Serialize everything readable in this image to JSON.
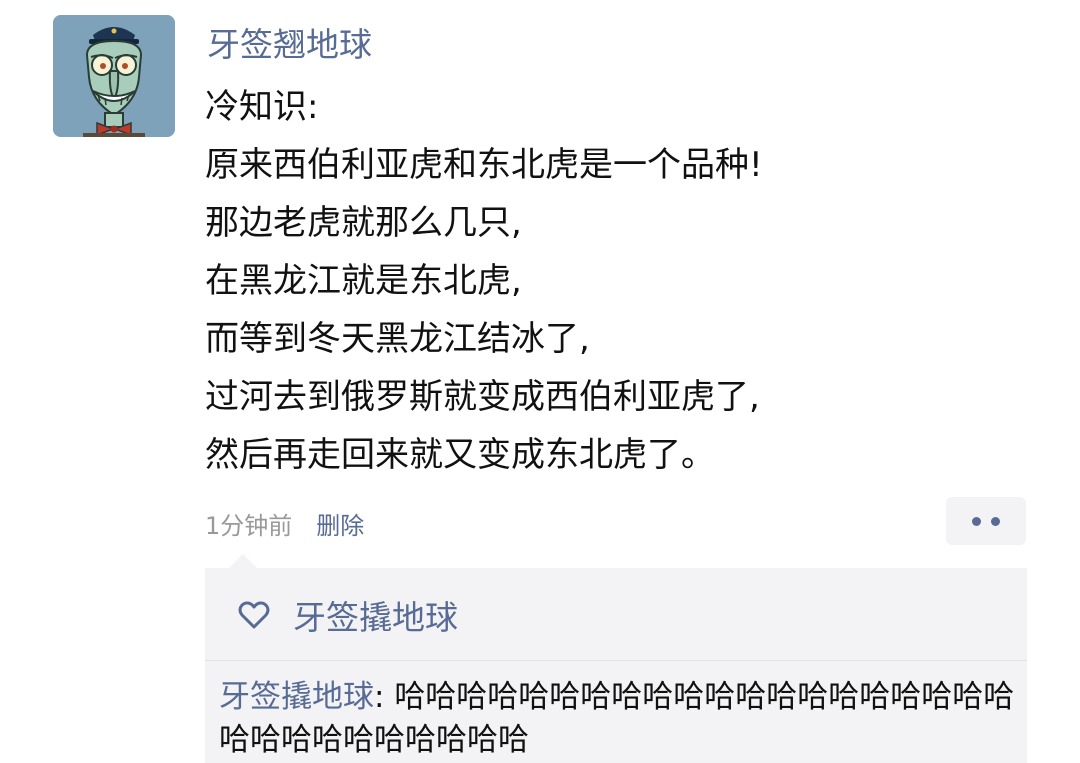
{
  "post": {
    "author": "牙签翘地球",
    "lines": [
      "冷知识:",
      "原来西伯利亚虎和东北虎是一个品种!",
      "那边老虎就那么几只,",
      "在黑龙江就是东北虎,",
      "而等到冬天黑龙江结冰了,",
      "过河去到俄罗斯就变成西伯利亚虎了,",
      "然后再走回来就又变成东北虎了。"
    ],
    "timestamp": "1分钟前",
    "delete_label": "删除"
  },
  "likes": {
    "icon": "heart-outline-icon",
    "names": "牙签撬地球"
  },
  "comment": {
    "author": "牙签撬地球",
    "separator": ": ",
    "text": "哈哈哈哈哈哈哈哈哈哈哈哈哈哈哈哈哈哈哈哈哈哈哈哈哈哈哈哈哈哈"
  },
  "colors": {
    "link": "#576b95",
    "text": "#111111",
    "muted": "#999999",
    "panel": "#f3f3f5"
  }
}
